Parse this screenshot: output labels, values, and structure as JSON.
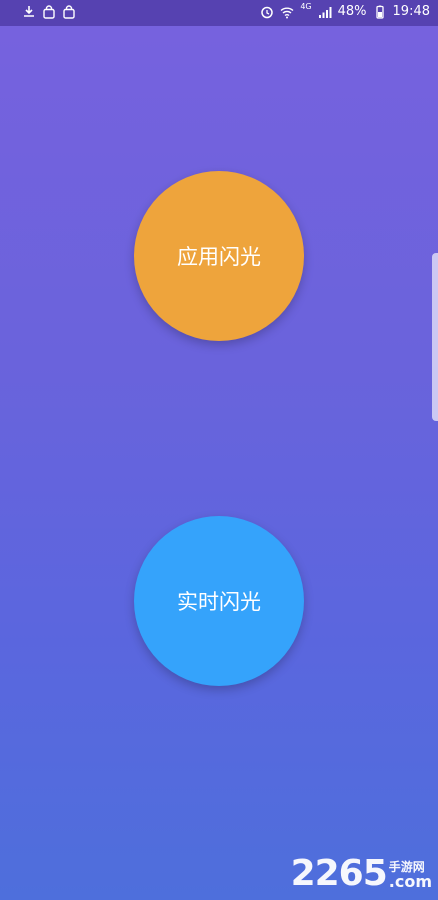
{
  "status_bar": {
    "network": "4G",
    "battery": "48%",
    "time": "19:48",
    "left_icons": [
      "download-icon",
      "shopping-bag-icon",
      "shopping-bag-icon"
    ],
    "right_icons": [
      "alarm-icon",
      "wifi-icon",
      "signal-icon",
      "battery-icon"
    ]
  },
  "buttons": {
    "app_flash": "应用闪光",
    "realtime_flash": "实时闪光"
  },
  "colors": {
    "app_flash": "#eea43c",
    "realtime_flash": "#35a3fb",
    "background_top": "#7762de",
    "background_bottom": "#4e6fdc"
  },
  "watermark": {
    "number": "2265",
    "site_cn": "手游网",
    "domain": ".com"
  }
}
